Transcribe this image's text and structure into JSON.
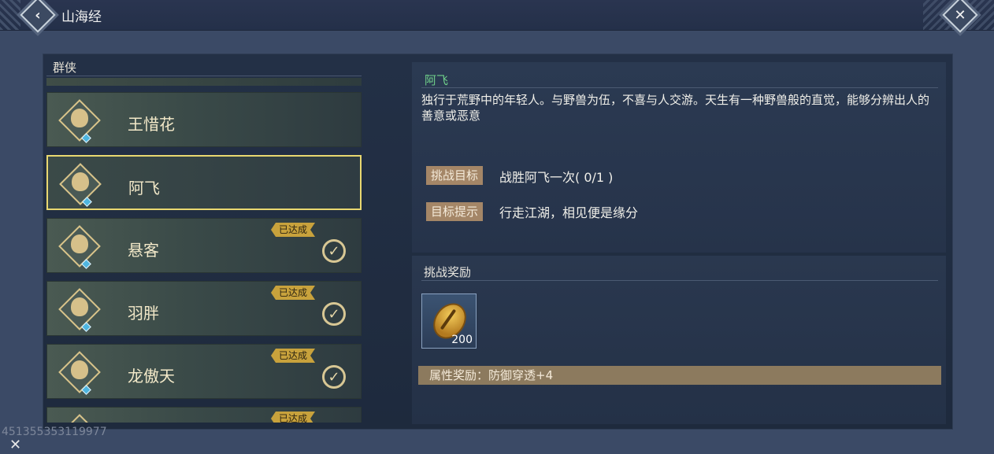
{
  "header": {
    "title": "山海经",
    "back_icon": "chevron-left-icon",
    "close_icon": "close-icon"
  },
  "list": {
    "header": "群侠",
    "items": [
      {
        "name": "王惜花",
        "selected": false,
        "achieved": false
      },
      {
        "name": "阿飞",
        "selected": true,
        "achieved": false
      },
      {
        "name": "悬客",
        "selected": false,
        "achieved": true,
        "badge": "已达成"
      },
      {
        "name": "羽胖",
        "selected": false,
        "achieved": true,
        "badge": "已达成"
      },
      {
        "name": "龙傲天",
        "selected": false,
        "achieved": true,
        "badge": "已达成"
      },
      {
        "name": "",
        "selected": false,
        "achieved": true,
        "badge": "已达成"
      }
    ]
  },
  "detail": {
    "name": "阿飞",
    "description": "独行于荒野中的年轻人。与野兽为伍，不喜与人交游。天生有一种野兽般的直觉，能够分辨出人的善意或恶意",
    "goal_label": "挑战目标",
    "goal_value": "战胜阿飞一次( 0/1 )",
    "hint_label": "目标提示",
    "hint_value": "行走江湖，相见便是缘分"
  },
  "reward": {
    "title": "挑战奖励",
    "item_icon": "shell-icon",
    "item_count": "200",
    "attribute": "属性奖励：防御穿透+4"
  },
  "footer": {
    "uid": "451355353119977"
  },
  "colors": {
    "accent_green": "#6fd08a",
    "selected_border": "#e9d870",
    "badge_gold": "#c8a23c"
  }
}
